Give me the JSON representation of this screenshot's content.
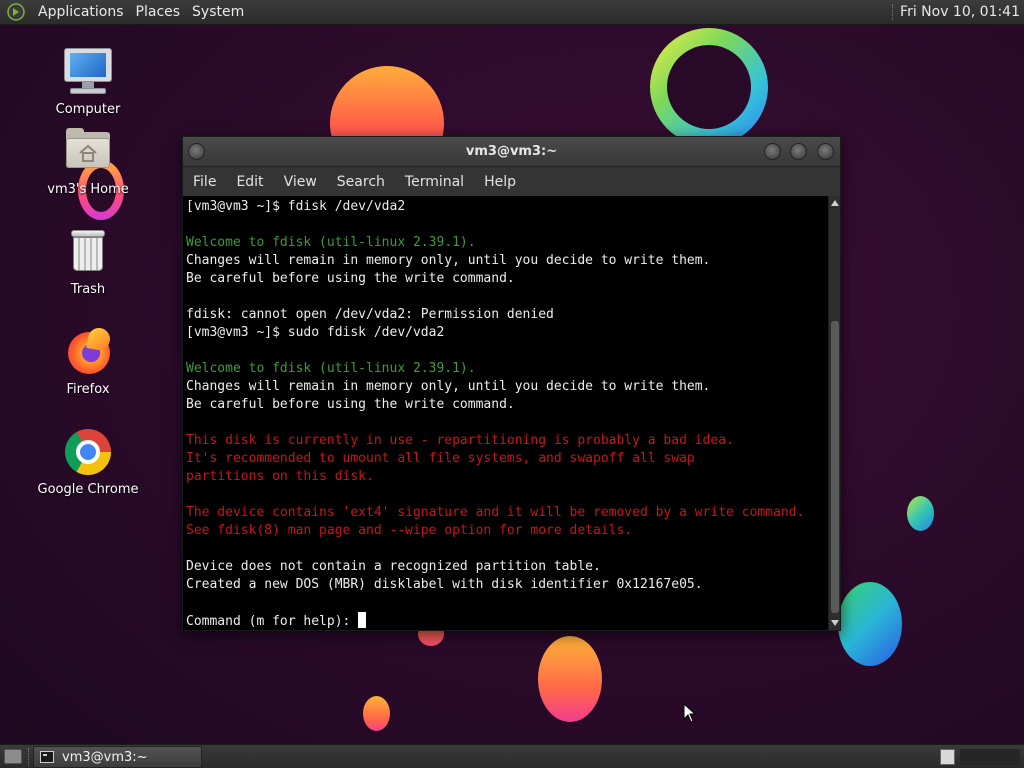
{
  "top_panel": {
    "menus": [
      "Applications",
      "Places",
      "System"
    ],
    "clock": "Fri Nov 10, 01:41"
  },
  "desktop_icons": [
    {
      "label": "Computer",
      "icon": "computer-icon"
    },
    {
      "label": "vm3's Home",
      "icon": "home-folder-icon"
    },
    {
      "label": "Trash",
      "icon": "trash-icon"
    },
    {
      "label": "Firefox",
      "icon": "firefox-icon"
    },
    {
      "label": "Google Chrome",
      "icon": "chrome-icon"
    }
  ],
  "terminal": {
    "title": "vm3@vm3:~",
    "menu": [
      "File",
      "Edit",
      "View",
      "Search",
      "Terminal",
      "Help"
    ],
    "lines": [
      {
        "text": "[vm3@vm3 ~]$ fdisk /dev/vda2",
        "color": "white"
      },
      {
        "text": "",
        "color": "white"
      },
      {
        "text": "Welcome to fdisk (util-linux 2.39.1).",
        "color": "green"
      },
      {
        "text": "Changes will remain in memory only, until you decide to write them.",
        "color": "white"
      },
      {
        "text": "Be careful before using the write command.",
        "color": "white"
      },
      {
        "text": "",
        "color": "white"
      },
      {
        "text": "fdisk: cannot open /dev/vda2: Permission denied",
        "color": "white"
      },
      {
        "text": "[vm3@vm3 ~]$ sudo fdisk /dev/vda2",
        "color": "white"
      },
      {
        "text": "",
        "color": "white"
      },
      {
        "text": "Welcome to fdisk (util-linux 2.39.1).",
        "color": "green"
      },
      {
        "text": "Changes will remain in memory only, until you decide to write them.",
        "color": "white"
      },
      {
        "text": "Be careful before using the write command.",
        "color": "white"
      },
      {
        "text": "",
        "color": "white"
      },
      {
        "text": "This disk is currently in use - repartitioning is probably a bad idea.",
        "color": "red"
      },
      {
        "text": "It's recommended to umount all file systems, and swapoff all swap",
        "color": "red"
      },
      {
        "text": "partitions on this disk.",
        "color": "red"
      },
      {
        "text": "",
        "color": "white"
      },
      {
        "text": "The device contains 'ext4' signature and it will be removed by a write command.",
        "color": "red"
      },
      {
        "text": "See fdisk(8) man page and --wipe option for more details.",
        "color": "red"
      },
      {
        "text": "",
        "color": "white"
      },
      {
        "text": "Device does not contain a recognized partition table.",
        "color": "white"
      },
      {
        "text": "Created a new DOS (MBR) disklabel with disk identifier 0x12167e05.",
        "color": "white"
      },
      {
        "text": "",
        "color": "white"
      }
    ],
    "prompt": "Command (m for help): "
  },
  "taskbar": {
    "window_button": "vm3@vm3:~"
  }
}
